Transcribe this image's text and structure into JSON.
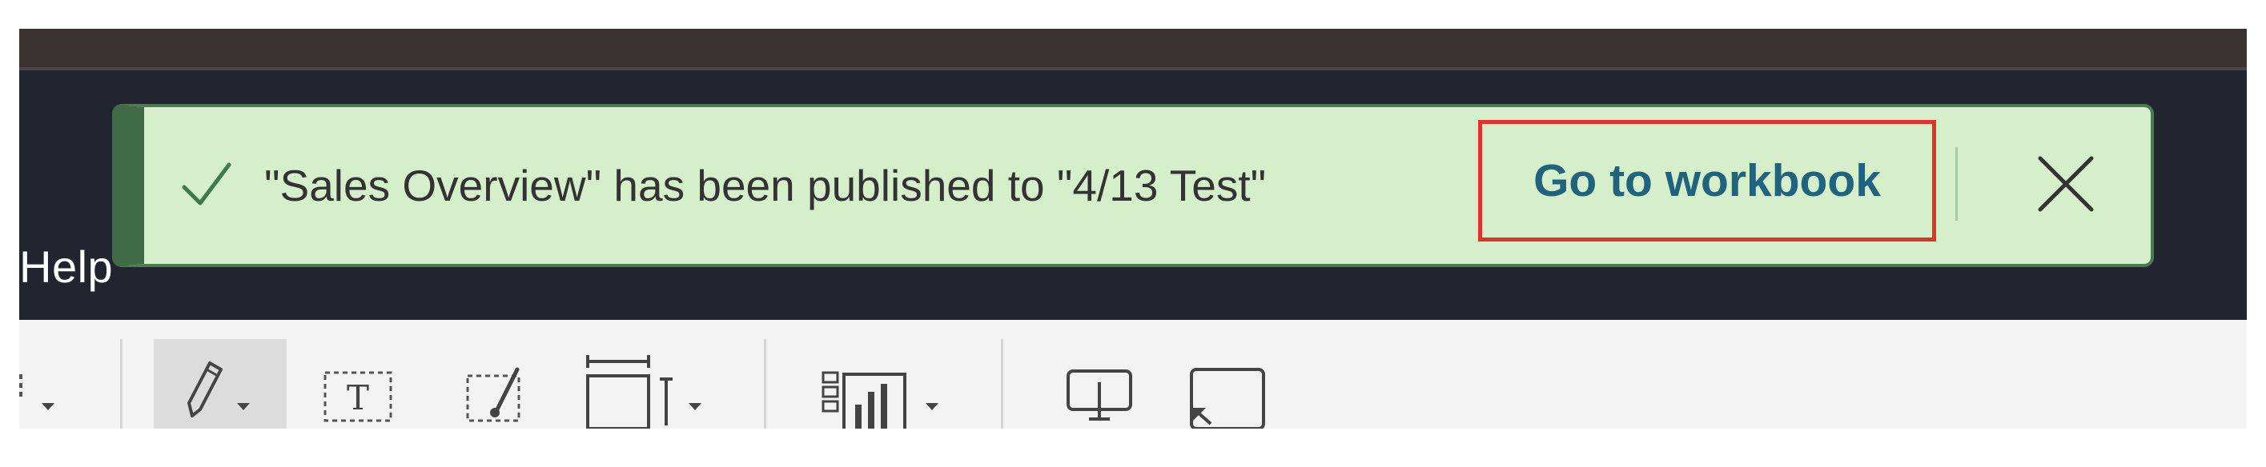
{
  "menu": {
    "visible_item": "Help"
  },
  "toast": {
    "status": "success",
    "status_icon": "checkmark-icon",
    "message": "\"Sales Overview\" has been published to \"4/13 Test\"",
    "link_label": "Go to workbook",
    "close_icon": "close-icon",
    "colors": {
      "background": "#d4efca",
      "accent": "#3f6c47",
      "link": "#21627f",
      "highlight_outline": "#e0342a"
    }
  },
  "toolbar": {
    "icons": [
      "dropdown-partial-icon",
      "highlighter-icon",
      "text-box-icon",
      "annotate-brush-icon",
      "fit-width-icon",
      "show-me-chart-icon",
      "presentation-icon",
      "share-screen-icon"
    ]
  }
}
